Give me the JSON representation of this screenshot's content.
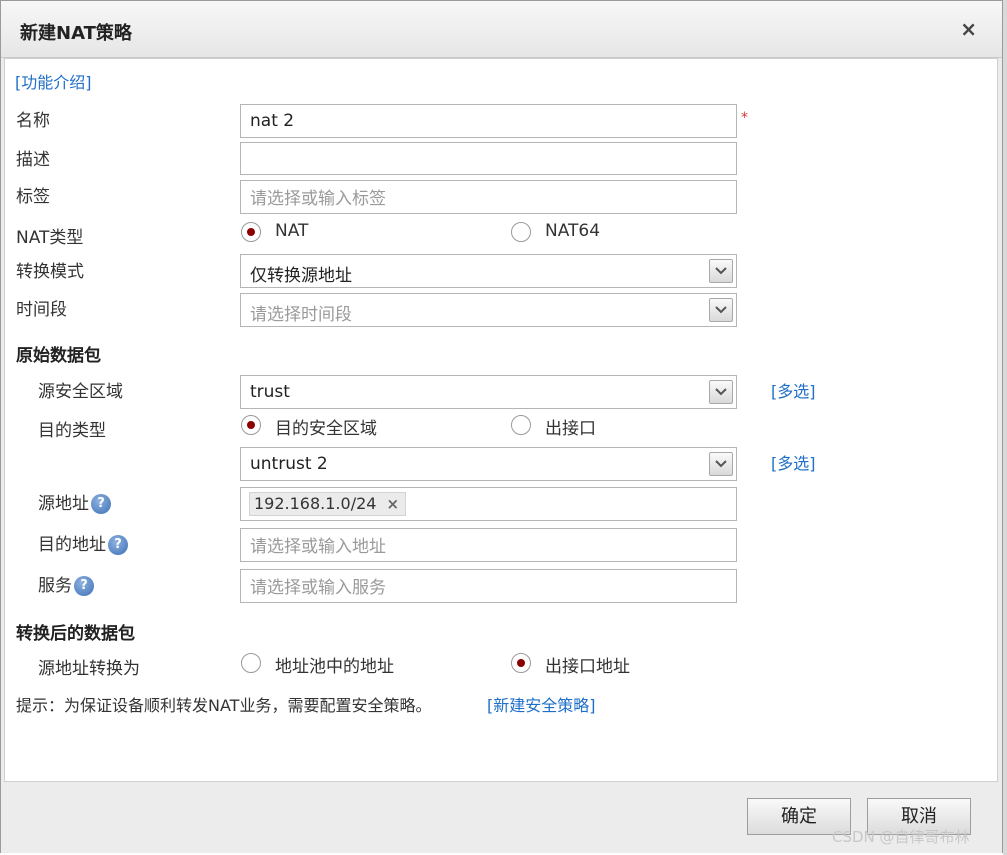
{
  "dialog": {
    "title": "新建NAT策略",
    "close_icon": "×"
  },
  "intro_link": "[功能介绍]",
  "fields": {
    "name": {
      "label": "名称",
      "value": "nat 2",
      "required_mark": "*"
    },
    "description": {
      "label": "描述",
      "value": ""
    },
    "tag": {
      "label": "标签",
      "placeholder": "请选择或输入标签"
    },
    "nat_type": {
      "label": "NAT类型",
      "options": [
        "NAT",
        "NAT64"
      ],
      "selected": "NAT"
    },
    "mode": {
      "label": "转换模式",
      "value": "仅转换源地址"
    },
    "time": {
      "label": "时间段",
      "placeholder": "请选择时间段"
    }
  },
  "original_packet": {
    "section_title": "原始数据包",
    "src_zone": {
      "label": "源安全区域",
      "value": "trust",
      "multi_link": "[多选]"
    },
    "dst_type": {
      "label": "目的类型",
      "options": [
        "目的安全区域",
        "出接口"
      ],
      "selected": "目的安全区域"
    },
    "dst_zone": {
      "value": "untrust 2",
      "multi_link": "[多选]"
    },
    "src_addr": {
      "label": "源地址",
      "tags": [
        "192.168.1.0/24"
      ]
    },
    "dst_addr": {
      "label": "目的地址",
      "placeholder": "请选择或输入地址"
    },
    "service": {
      "label": "服务",
      "placeholder": "请选择或输入服务"
    }
  },
  "translated_packet": {
    "section_title": "转换后的数据包",
    "src_translate": {
      "label": "源地址转换为",
      "options": [
        "地址池中的地址",
        "出接口地址"
      ],
      "selected": "出接口地址"
    }
  },
  "tip": {
    "text": "提示：为保证设备顺利转发NAT业务，需要配置安全策略。",
    "link": "[新建安全策略]"
  },
  "buttons": {
    "ok": "确定",
    "cancel": "取消"
  },
  "watermark": "CSDN @自律哥布林",
  "colors": {
    "link": "#1f6fc8",
    "radio_selected": "#8b0000",
    "required": "#dd3333"
  },
  "icons": {
    "help": "question-circle",
    "dropdown": "chevron-down",
    "tag_remove": "×"
  }
}
